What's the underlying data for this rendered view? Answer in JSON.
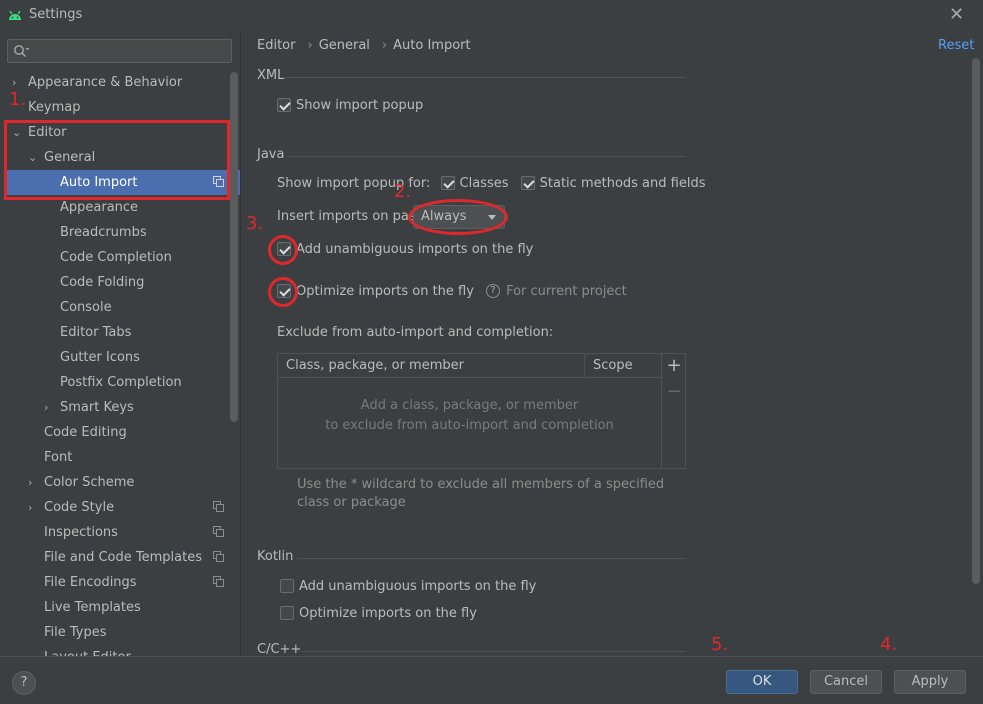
{
  "window": {
    "title": "Settings",
    "close_icon": "close-icon"
  },
  "search": {
    "placeholder": ""
  },
  "sidebar": {
    "items": [
      {
        "label": "Appearance & Behavior",
        "arrow": "›"
      },
      {
        "label": "Keymap",
        "arrow": ""
      },
      {
        "label": "Editor",
        "arrow": "⌄"
      },
      {
        "label": "General",
        "arrow": "⌄"
      },
      {
        "label": "Auto Import",
        "arrow": ""
      },
      {
        "label": "Appearance",
        "arrow": ""
      },
      {
        "label": "Breadcrumbs",
        "arrow": ""
      },
      {
        "label": "Code Completion",
        "arrow": ""
      },
      {
        "label": "Code Folding",
        "arrow": ""
      },
      {
        "label": "Console",
        "arrow": ""
      },
      {
        "label": "Editor Tabs",
        "arrow": ""
      },
      {
        "label": "Gutter Icons",
        "arrow": ""
      },
      {
        "label": "Postfix Completion",
        "arrow": ""
      },
      {
        "label": "Smart Keys",
        "arrow": "›"
      },
      {
        "label": "Code Editing",
        "arrow": ""
      },
      {
        "label": "Font",
        "arrow": ""
      },
      {
        "label": "Color Scheme",
        "arrow": "›"
      },
      {
        "label": "Code Style",
        "arrow": "›"
      },
      {
        "label": "Inspections",
        "arrow": ""
      },
      {
        "label": "File and Code Templates",
        "arrow": ""
      },
      {
        "label": "File Encodings",
        "arrow": ""
      },
      {
        "label": "Live Templates",
        "arrow": ""
      },
      {
        "label": "File Types",
        "arrow": ""
      },
      {
        "label": "Layout Editor",
        "arrow": ""
      }
    ]
  },
  "breadcrumb": {
    "part1": "Editor",
    "part2": "General",
    "part3": "Auto Import",
    "separator": "›"
  },
  "reset_label": "Reset",
  "xml": {
    "title": "XML",
    "show_import_popup": {
      "label": "Show import popup",
      "checked": true
    }
  },
  "java": {
    "title": "Java",
    "show_popup_for_label": "Show import popup for:",
    "classes": {
      "label": "Classes",
      "checked": true
    },
    "static_methods": {
      "label": "Static methods and fields",
      "checked": true
    },
    "insert_on_paste_label": "Insert imports on paste:",
    "insert_on_paste_value": "Always",
    "add_unambiguous": {
      "label": "Add unambiguous imports on the fly",
      "checked": true
    },
    "optimize_imports": {
      "label": "Optimize imports on the fly",
      "checked": true
    },
    "help_glyph": "?",
    "for_current_project": "For current project",
    "exclude_label": "Exclude from auto-import and completion:",
    "table": {
      "columns": [
        "Class, package, or member",
        "Scope"
      ],
      "add_glyph": "+",
      "remove_glyph": "−",
      "empty_line1": "Add a class, package, or member",
      "empty_line2": "to exclude from auto-import and completion"
    },
    "wildcard_note": "Use the * wildcard to exclude all members of a specified class or package"
  },
  "kotlin": {
    "title": "Kotlin",
    "add_unambiguous": {
      "label": "Add unambiguous imports on the fly",
      "checked": false
    },
    "optimize_imports": {
      "label": "Optimize imports on the fly",
      "checked": false
    }
  },
  "cpp": {
    "title": "C/C++"
  },
  "annotations": {
    "a1": "1.",
    "a2": "2.",
    "a3": "3.",
    "a4": "4.",
    "a5": "5."
  },
  "footer": {
    "help_glyph": "?",
    "ok": "OK",
    "cancel": "Cancel",
    "apply": "Apply"
  },
  "colors": {
    "accent": "#4b6eaf",
    "link": "#589df6",
    "annotation": "#e0282c",
    "primary_button": "#365880"
  }
}
